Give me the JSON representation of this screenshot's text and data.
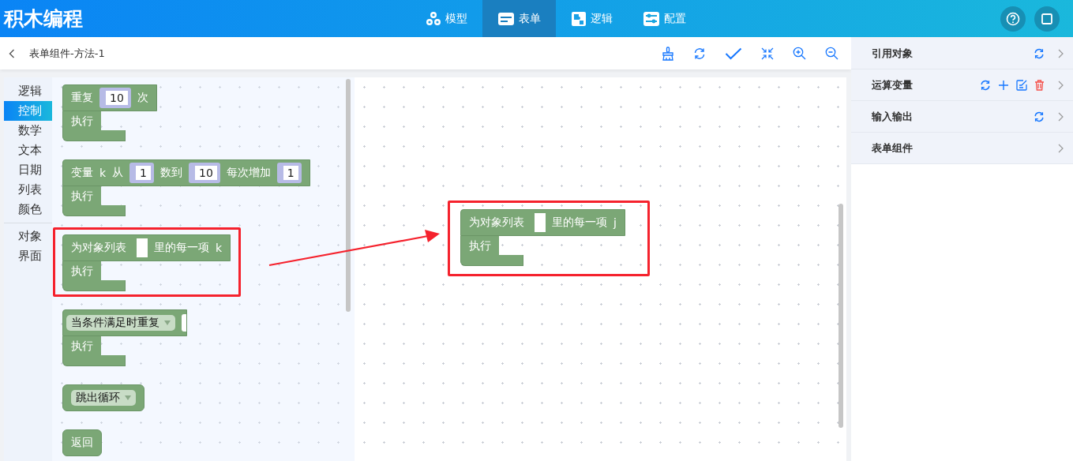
{
  "app_title": "积木编程",
  "nav_tabs": [
    {
      "label": "模型",
      "selected": false
    },
    {
      "label": "表单",
      "selected": true
    },
    {
      "label": "逻辑",
      "selected": false
    },
    {
      "label": "配置",
      "selected": false
    }
  ],
  "header_buttons": [
    {
      "kind": "help"
    },
    {
      "kind": "square"
    }
  ],
  "toolbar": {
    "breadcrumb": "表单组件-方法-1",
    "tools": [
      {
        "kind": "brush"
      },
      {
        "kind": "refresh"
      },
      {
        "kind": "check"
      },
      {
        "kind": "collapse"
      },
      {
        "kind": "zoom-in"
      },
      {
        "kind": "zoom-out"
      }
    ]
  },
  "category_groups": [
    [
      {
        "label": "逻辑",
        "selected": false
      },
      {
        "label": "控制",
        "selected": true
      },
      {
        "label": "数学",
        "selected": false
      },
      {
        "label": "文本",
        "selected": false
      },
      {
        "label": "日期",
        "selected": false
      },
      {
        "label": "列表",
        "selected": false
      },
      {
        "label": "颜色",
        "selected": false
      }
    ],
    [
      {
        "label": "对象",
        "selected": false
      },
      {
        "label": "界面",
        "selected": false
      }
    ]
  ],
  "palette_blocks": [
    {
      "kind": "c",
      "highlighted": false,
      "parts": [
        {
          "kind": "label",
          "text": "重复"
        },
        {
          "kind": "number",
          "text": "10"
        },
        {
          "kind": "label",
          "text": "次"
        }
      ],
      "body_label": "执行"
    },
    {
      "kind": "c",
      "highlighted": false,
      "parts": [
        {
          "kind": "label",
          "text": "变量"
        },
        {
          "kind": "label",
          "text": "k"
        },
        {
          "kind": "label",
          "text": "从"
        },
        {
          "kind": "number",
          "text": "1"
        },
        {
          "kind": "label",
          "text": "数到"
        },
        {
          "kind": "number",
          "text": "10"
        },
        {
          "kind": "label",
          "text": "每次增加"
        },
        {
          "kind": "number",
          "text": "1"
        }
      ],
      "body_label": "执行"
    },
    {
      "kind": "c",
      "highlighted": true,
      "parts": [
        {
          "kind": "label",
          "text": "为对象列表"
        },
        {
          "kind": "socket"
        },
        {
          "kind": "label",
          "text": "里的每一项"
        },
        {
          "kind": "label",
          "text": "k"
        }
      ],
      "body_label": "执行"
    },
    {
      "kind": "c",
      "highlighted": false,
      "parts": [
        {
          "kind": "dropdown",
          "text": "当条件满足时重复"
        },
        {
          "kind": "open"
        }
      ],
      "body_label": "执行"
    },
    {
      "kind": "single",
      "highlighted": false,
      "parts": [
        {
          "kind": "dropdown",
          "text": "跳出循环"
        }
      ]
    },
    {
      "kind": "single",
      "highlighted": false,
      "parts": [
        {
          "kind": "label",
          "text": "返回"
        }
      ]
    }
  ],
  "canvas_blocks": [
    {
      "kind": "c",
      "highlighted": true,
      "parts": [
        {
          "kind": "label",
          "text": "为对象列表"
        },
        {
          "kind": "socket"
        },
        {
          "kind": "label",
          "text": "里的每一项"
        },
        {
          "kind": "label",
          "text": "j"
        }
      ],
      "body_label": "执行"
    }
  ],
  "side_panels": [
    {
      "label": "引用对象",
      "actions": [
        {
          "kind": "refresh"
        }
      ]
    },
    {
      "label": "运算变量",
      "actions": [
        {
          "kind": "refresh"
        },
        {
          "kind": "add"
        },
        {
          "kind": "edit"
        },
        {
          "kind": "delete"
        }
      ]
    },
    {
      "label": "输入输出",
      "actions": [
        {
          "kind": "refresh"
        }
      ]
    },
    {
      "label": "表单组件"
    }
  ]
}
